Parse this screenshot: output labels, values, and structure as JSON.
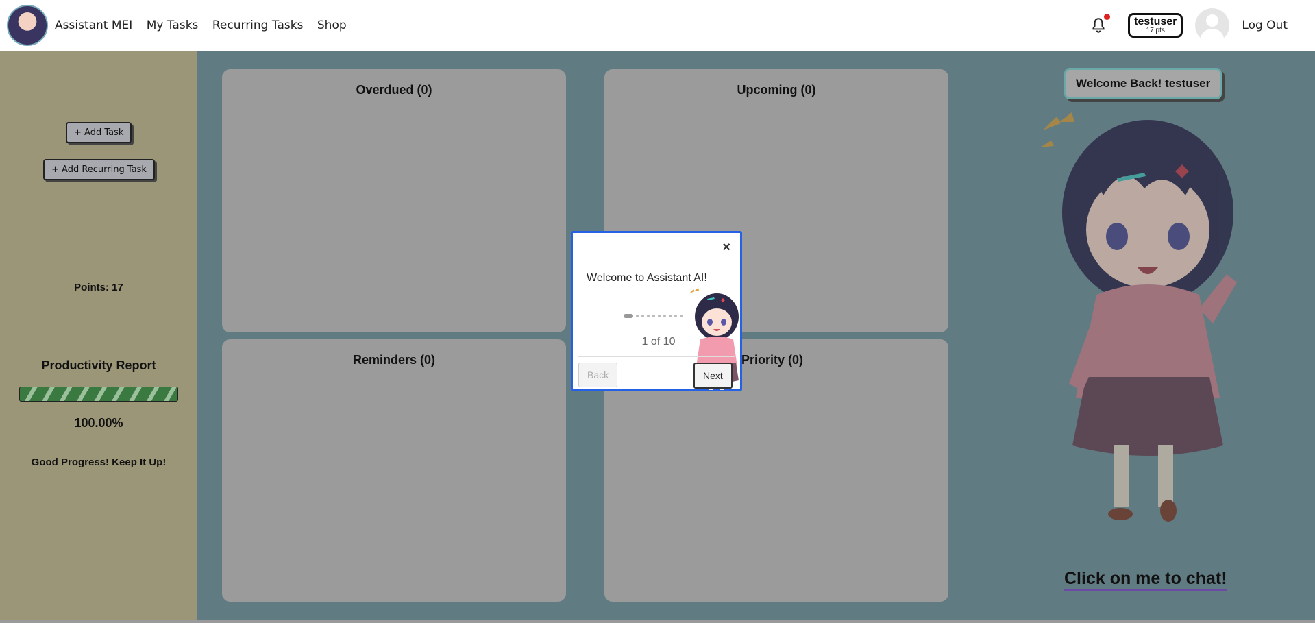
{
  "header": {
    "app_name": "Assistant MEI",
    "nav": [
      {
        "label": "My Tasks"
      },
      {
        "label": "Recurring Tasks"
      },
      {
        "label": "Shop"
      }
    ],
    "username": "testuser",
    "points_badge": "17 pts",
    "logout": "Log Out"
  },
  "sidebar": {
    "add_task": "+ Add Task",
    "add_recurring": "+ Add Recurring Task",
    "points": "Points: 17",
    "productivity_title": "Productivity Report",
    "progress": 1.0,
    "percent": "100.00%",
    "message": "Good Progress! Keep It Up!"
  },
  "panels": [
    {
      "title": "Overdued (0)"
    },
    {
      "title": "Upcoming (0)"
    },
    {
      "title": "Reminders (0)"
    },
    {
      "title": "Priority (0)"
    }
  ],
  "character": {
    "welcome": "Welcome Back! testuser",
    "chat_prompt": "Click on me to chat!"
  },
  "modal": {
    "close": "×",
    "welcome_text": "Welcome to Assistant AI!",
    "counter": "1 of 10",
    "back": "Back",
    "next": "Next"
  },
  "colors": {
    "accent": "#2561e5",
    "sidebar": "#9b9678",
    "main": "#617b82",
    "progress": "#3a7a40"
  }
}
